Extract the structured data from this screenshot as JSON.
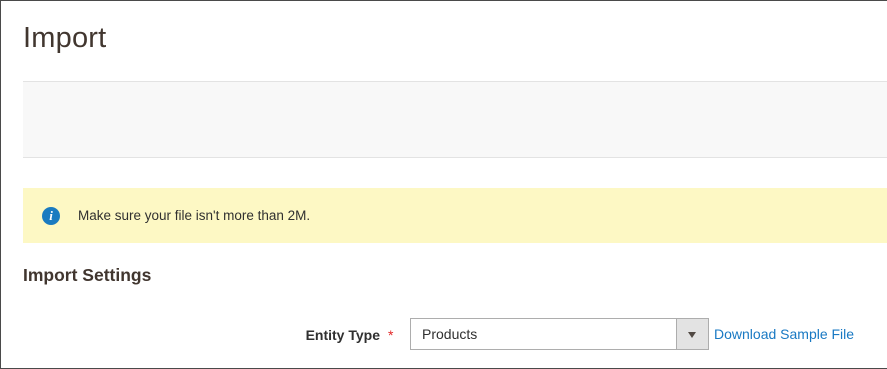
{
  "page": {
    "title": "Import"
  },
  "notice": {
    "icon": "info-icon",
    "text": "Make sure your file isn't more than 2M."
  },
  "import_settings": {
    "title": "Import Settings",
    "entity_type": {
      "label": "Entity Type",
      "required_mark": "*",
      "selected_value": "Products"
    },
    "download_sample_label": "Download Sample File"
  },
  "colors": {
    "notice_background": "#fdf8c4",
    "info_icon": "#1a7bc0",
    "link": "#1979c3",
    "required": "#e22626",
    "actions_bar": "#f8f8f8"
  }
}
